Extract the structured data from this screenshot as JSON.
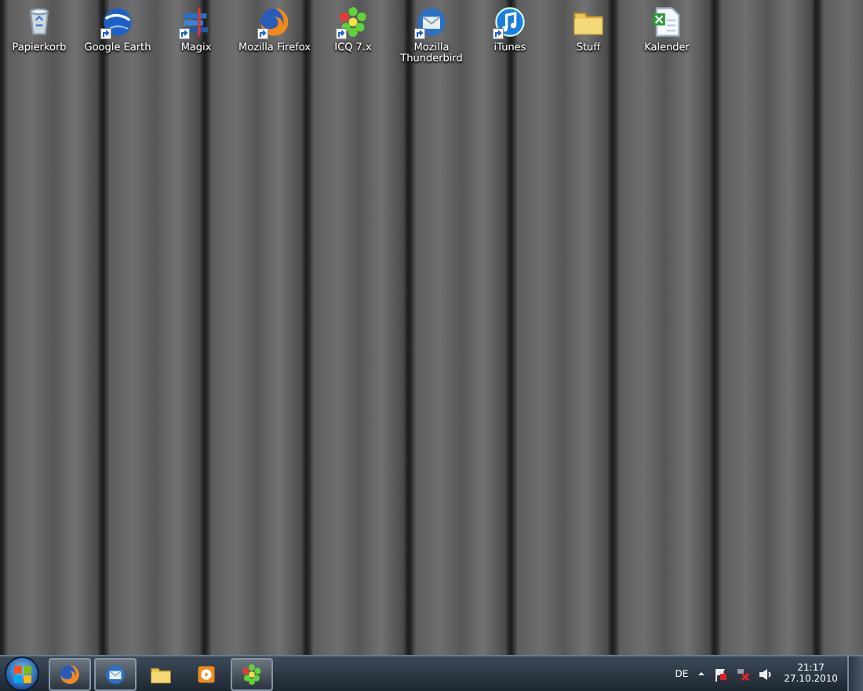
{
  "desktop_icons": [
    {
      "label": "Papierkorb",
      "kind": "recycle-bin",
      "shortcut": false
    },
    {
      "label": "Google Earth",
      "kind": "globe",
      "shortcut": true
    },
    {
      "label": "Magix",
      "kind": "bars",
      "shortcut": true
    },
    {
      "label": "Mozilla Firefox",
      "kind": "browser",
      "shortcut": true
    },
    {
      "label": "ICQ 7.x",
      "kind": "flower",
      "shortcut": true
    },
    {
      "label": "Mozilla Thunderbird",
      "kind": "mail",
      "shortcut": true
    },
    {
      "label": "iTunes",
      "kind": "music",
      "shortcut": true
    },
    {
      "label": "Stuff",
      "kind": "folder",
      "shortcut": false
    },
    {
      "label": "Kalender",
      "kind": "spreadsheet",
      "shortcut": false
    }
  ],
  "taskbar": {
    "items": [
      {
        "kind": "browser",
        "running": true
      },
      {
        "kind": "mail",
        "running": true
      },
      {
        "kind": "folder",
        "running": false
      },
      {
        "kind": "player",
        "running": false
      },
      {
        "kind": "flower",
        "running": true
      }
    ],
    "tray": {
      "language": "DE",
      "time": "21:17",
      "date": "27.10.2010"
    }
  }
}
